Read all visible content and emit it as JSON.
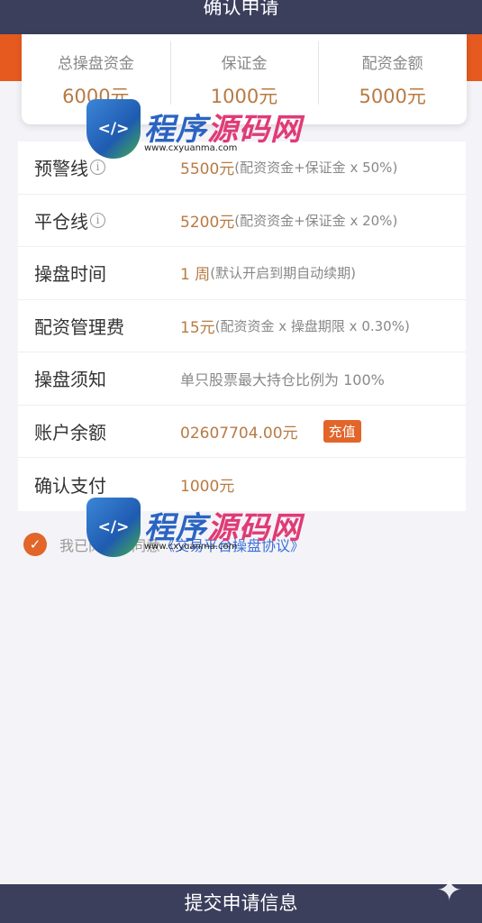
{
  "header": {
    "title": "确认申请"
  },
  "summary": [
    {
      "label": "总操盘资金",
      "value": "6000元"
    },
    {
      "label": "保证金",
      "value": "1000元"
    },
    {
      "label": "配资金额",
      "value": "5000元"
    }
  ],
  "rows": [
    {
      "label": "预警线",
      "value": "5500元",
      "note": "(配资资金+保证金 x 50%)"
    },
    {
      "label": "平仓线",
      "value": "5200元",
      "note": "(配资资金+保证金 x 20%)"
    },
    {
      "label": "操盘时间",
      "value": "1 周",
      "note": "(默认开启到期自动续期)"
    },
    {
      "label": "配资管理费",
      "value": "15元",
      "note": "(配资资金 x 操盘期限 x 0.30%)"
    },
    {
      "label": "操盘须知",
      "value": "单只股票最大持仓比例为 100%"
    },
    {
      "label": "账户余额",
      "value": "02607704.00元",
      "button": "充值"
    },
    {
      "label": "确认支付",
      "value": "1000元"
    }
  ],
  "agreement": {
    "text": "我已阅读并同意",
    "link": "《交易平台操盘协议》"
  },
  "watermark": {
    "title_a": "程序",
    "title_b": "源码网",
    "url": "www.cxyuanma.com",
    "badge": "</>"
  },
  "footer": {
    "submit": "提交申请信息"
  },
  "colors": {
    "header_bg": "#3b3f5c",
    "accent": "#e2652a",
    "amount": "#b87a43"
  },
  "icons": {
    "info": "info-circle-icon",
    "check": "check-circle-icon",
    "sparkle": "sparkle-icon"
  }
}
